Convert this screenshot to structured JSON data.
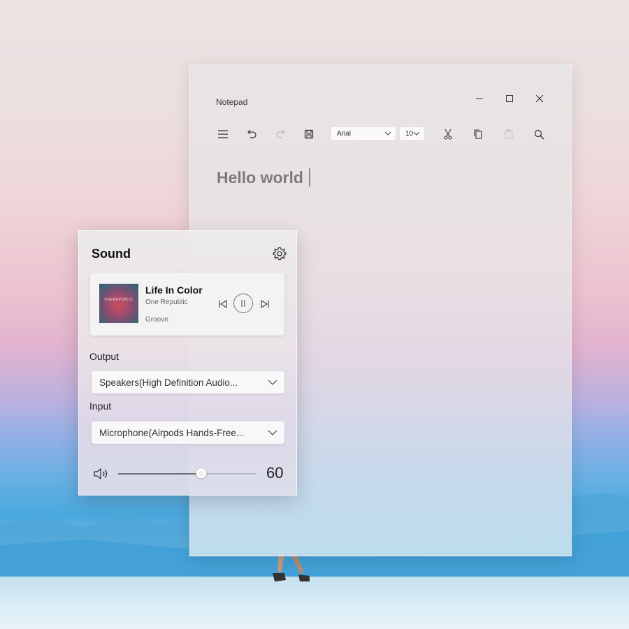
{
  "notepad": {
    "title": "Notepad",
    "font_name": "Arial",
    "font_size": "10",
    "document_text": "Hello world"
  },
  "sound": {
    "title": "Sound",
    "media": {
      "track_title": "Life In Color",
      "artist": "One Republic",
      "app": "Groove",
      "album_art_text": "ONEREPUBLIC"
    },
    "output_label": "Output",
    "output_device": "Speakers(High Definition Audio...",
    "input_label": "Input",
    "input_device": "Microphone(Airpods Hands-Free...",
    "volume": 60,
    "volume_label": "60"
  }
}
